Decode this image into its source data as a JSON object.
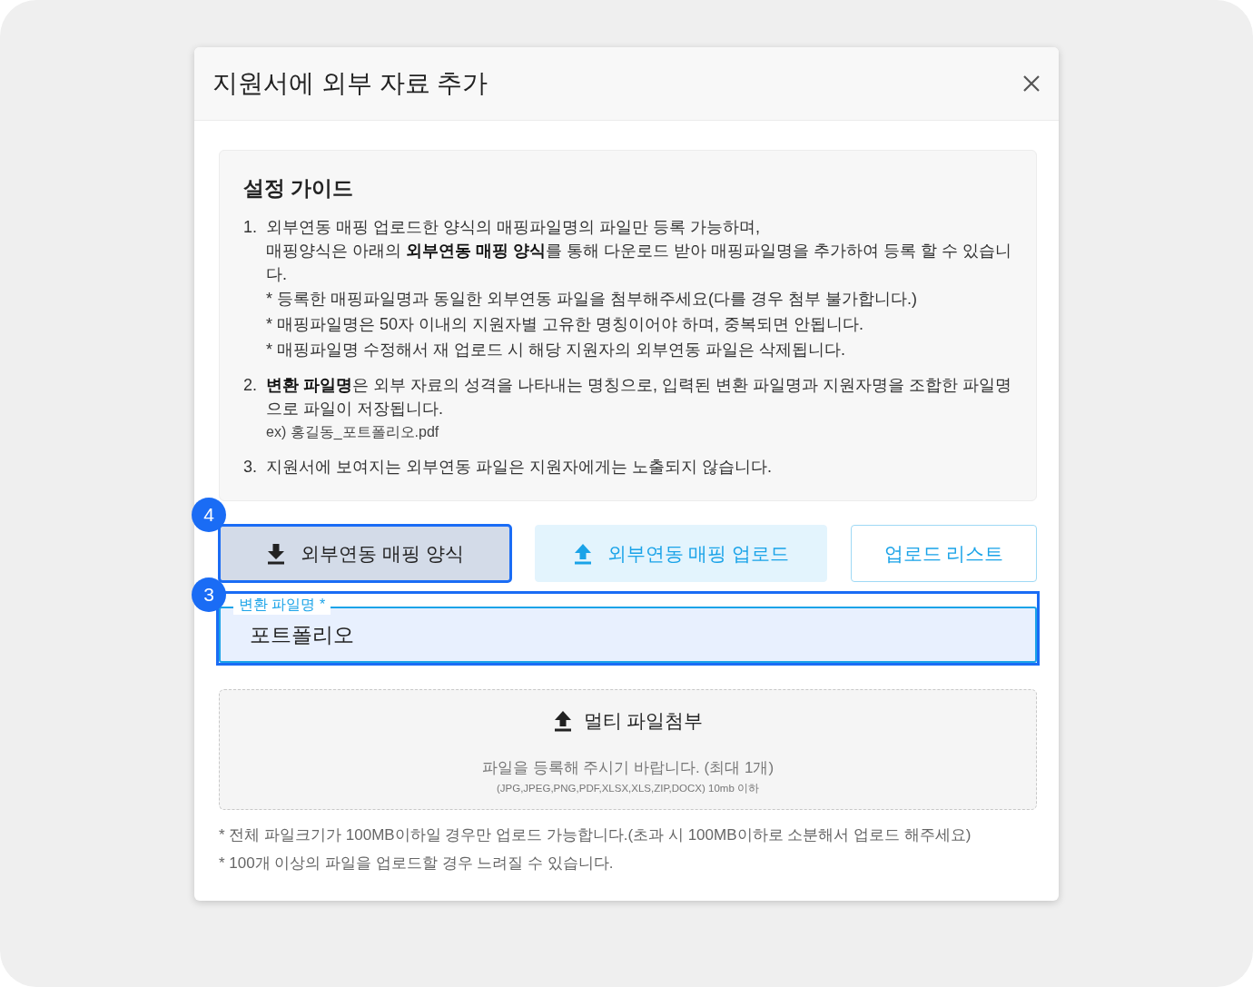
{
  "dialog": {
    "title": "지원서에 외부 자료 추가"
  },
  "guide": {
    "title": "설정 가이드",
    "items": [
      {
        "number": "1.",
        "lines": [
          "외부연동 매핑 업로드한 양식의 매핑파일명의 파일만 등록 가능하며,",
          "매핑양식은 아래의 **외부연동 매핑 양식**를 통해 다운로드 받아 매핑파일명을 추가하여 등록 할 수 있습니다."
        ],
        "notes": [
          "* 등록한 매핑파일명과 동일한 외부연동 파일을 첨부해주세요(다를 경우 첨부 불가합니다.)",
          "* 매핑파일명은 50자 이내의 지원자별 고유한 명칭이어야 하며, 중복되면 안됩니다.",
          "* 매핑파일명 수정해서 재 업로드 시 해당 지원자의 외부연동 파일은 삭제됩니다."
        ]
      },
      {
        "number": "2.",
        "lines": [
          "**변환 파일명**은 외부 자료의 성격을 나타내는 명칭으로, 입력된 변환 파일명과 지원자명을 조합한 파일명으로 파일이 저장됩니다."
        ],
        "example": "ex) 홍길동_포트폴리오.pdf"
      },
      {
        "number": "3.",
        "lines": [
          "지원서에 보여지는 외부연동 파일은 지원자에게는 노출되지 않습니다."
        ]
      }
    ]
  },
  "actions": [
    {
      "kind": "download",
      "label": "외부연동 매핑 양식",
      "highlighted": true,
      "step": "4"
    },
    {
      "kind": "upload",
      "label": "외부연동 매핑 업로드",
      "highlighted": false
    },
    {
      "kind": "list",
      "label": "업로드 리스트",
      "highlighted": false
    }
  ],
  "filename_field": {
    "label": "변환 파일명 *",
    "value": "포트폴리오",
    "highlighted": true,
    "step": "3"
  },
  "dropzone": {
    "title": "멀티 파일첨부",
    "hint": "파일을 등록해 주시기 바랍니다. (최대 1개)",
    "formats": "(JPG,JPEG,PNG,PDF,XLSX,XLS,ZIP,DOCX) 10mb 이하"
  },
  "notes": [
    "* 전체 파일크기가 100MB이하일 경우만 업로드 가능합니다.(초과 시 100MB이하로 소분해서 업로드 해주세요)",
    "* 100개 이상의 파일을 업로드할 경우 느려질 수 있습니다."
  ]
}
